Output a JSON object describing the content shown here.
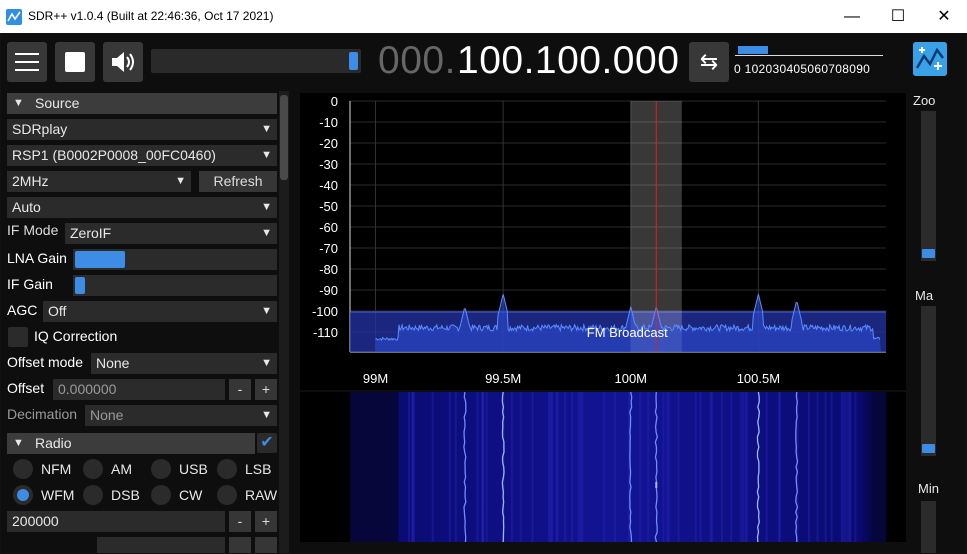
{
  "window": {
    "title": "SDR++ v1.0.4 (Built at 22:46:36, Oct 17 2021)",
    "minimize_glyph": "—",
    "maximize_glyph": "☐",
    "close_glyph": "✕"
  },
  "toolbar": {
    "menu_icon": "hamburger-menu-icon",
    "stop_icon": "stop-icon",
    "volume_icon": "speaker-icon",
    "volume_level": 1.0,
    "frequency_leading": "000.",
    "frequency_main": "100.100.000",
    "tuning_icon": "swap-arrows-icon",
    "tuning_glyph": "⇆",
    "snr_labels": "0 102030405060708090",
    "snr_level": 20,
    "accent": "#3d8ce5"
  },
  "source": {
    "header": "Source",
    "device": "SDRplay",
    "serial": "RSP1 (B0002P0008_00FC0460)",
    "bandwidth": "2MHz",
    "refresh_label": "Refresh",
    "antenna": "Auto",
    "if_mode_label": "IF Mode",
    "if_mode_value": "ZeroIF",
    "lna_gain_label": "LNA Gain",
    "lna_gain_level": 0.25,
    "if_gain_label": "IF Gain",
    "if_gain_level": 0.05,
    "agc_label": "AGC",
    "agc_value": "Off",
    "iq_correction_label": "IQ Correction",
    "offset_mode_label": "Offset mode",
    "offset_mode_value": "None",
    "offset_label": "Offset",
    "offset_value": "0.000000",
    "minus": "-",
    "plus": "+",
    "decimation_label": "Decimation",
    "decimation_value": "None"
  },
  "radio": {
    "header": "Radio",
    "enabled_glyph": "✔",
    "modes": [
      "NFM",
      "AM",
      "USB",
      "LSB",
      "WFM",
      "DSB",
      "CW",
      "RAW"
    ],
    "selected_mode": "WFM",
    "bandwidth_value": "200000"
  },
  "spectrum": {
    "y_ticks": [
      "0",
      "-10",
      "-20",
      "-30",
      "-40",
      "-50",
      "-60",
      "-70",
      "-80",
      "-90",
      "-100",
      "-110"
    ],
    "x_ticks": [
      "99M",
      "99.5M",
      "100M",
      "100.5M"
    ],
    "band_label": "FM Broadcast",
    "tuned_frequency_mhz": 100.1,
    "vfo_bandwidth_mhz": 0.2,
    "x_range_mhz": [
      98.9,
      101.0
    ],
    "y_range_db": [
      -120,
      0
    ],
    "peaks_mhz": [
      99.35,
      99.5,
      100.0,
      100.1,
      100.5,
      100.65
    ],
    "trace_color": "#5b8cff",
    "vfo_line_color": "#e02020"
  },
  "right_panel": {
    "zoom_label": "Zoo",
    "zoom_level": 0.0,
    "max_label": "Ma",
    "max_level": 0.0,
    "min_label": "Min"
  }
}
